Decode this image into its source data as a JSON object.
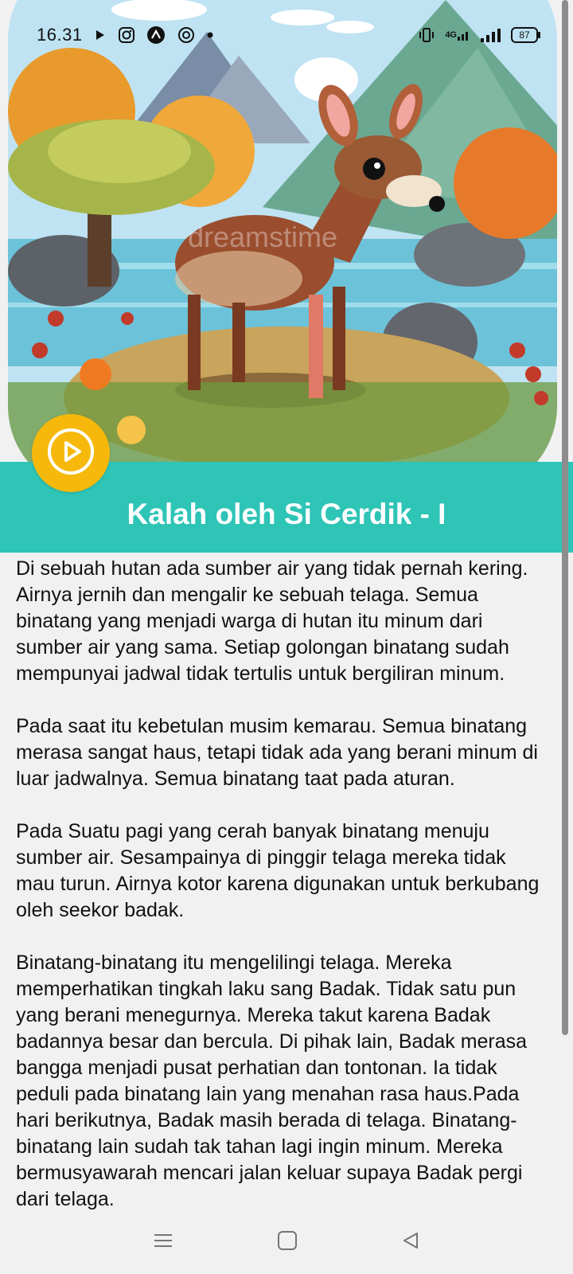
{
  "status_bar": {
    "time": "16.31",
    "network_label": "4G",
    "battery_level": "87"
  },
  "story": {
    "title": "Kalah oleh Si Cerdik - I",
    "paragraphs": [
      "Di sebuah hutan ada sumber air yang tidak pernah kering. Airnya jernih dan mengalir ke sebuah telaga. Semua binatang yang menjadi warga di hutan itu minum dari sumber air yang sama. Setiap golongan binatang sudah mempunyai jadwal tidak tertulis untuk bergiliran minum.",
      "Pada saat itu kebetulan musim kemarau. Semua binatang merasa sangat haus, tetapi tidak ada yang berani minum di luar jadwalnya. Semua binatang taat pada aturan.",
      "Pada Suatu pagi yang cerah banyak binatang menuju sumber air. Sesampainya di pinggir telaga mereka tidak mau turun. Airnya kotor karena digunakan untuk berkubang oleh seekor badak.",
      "Binatang-binatang itu mengelilingi telaga. Mereka memperhatikan tingkah laku sang Badak. Tidak satu pun yang berani menegurnya. Mereka takut karena Badak badannya besar dan bercula. Di pihak lain, Badak merasa bangga menjadi pusat perhatian dan tontonan. Ia tidak peduli pada binatang lain yang menahan rasa haus.Pada hari berikutnya, Badak masih berada di telaga. Binatang-binatang lain sudah tak tahan lagi ingin minum. Mereka bermusyawarah mencari jalan keluar supaya Badak pergi dari telaga."
    ]
  },
  "watermark": "dreamstime",
  "colors": {
    "accent": "#2ec4b6",
    "play_button": "#f6b90b",
    "background": "#f1f1f1"
  },
  "icons": [
    "play-icon",
    "instagram-icon",
    "chatgpt-icon",
    "vibrate-icon",
    "signal-icon",
    "battery-icon",
    "menu-icon",
    "home-icon",
    "back-icon"
  ]
}
